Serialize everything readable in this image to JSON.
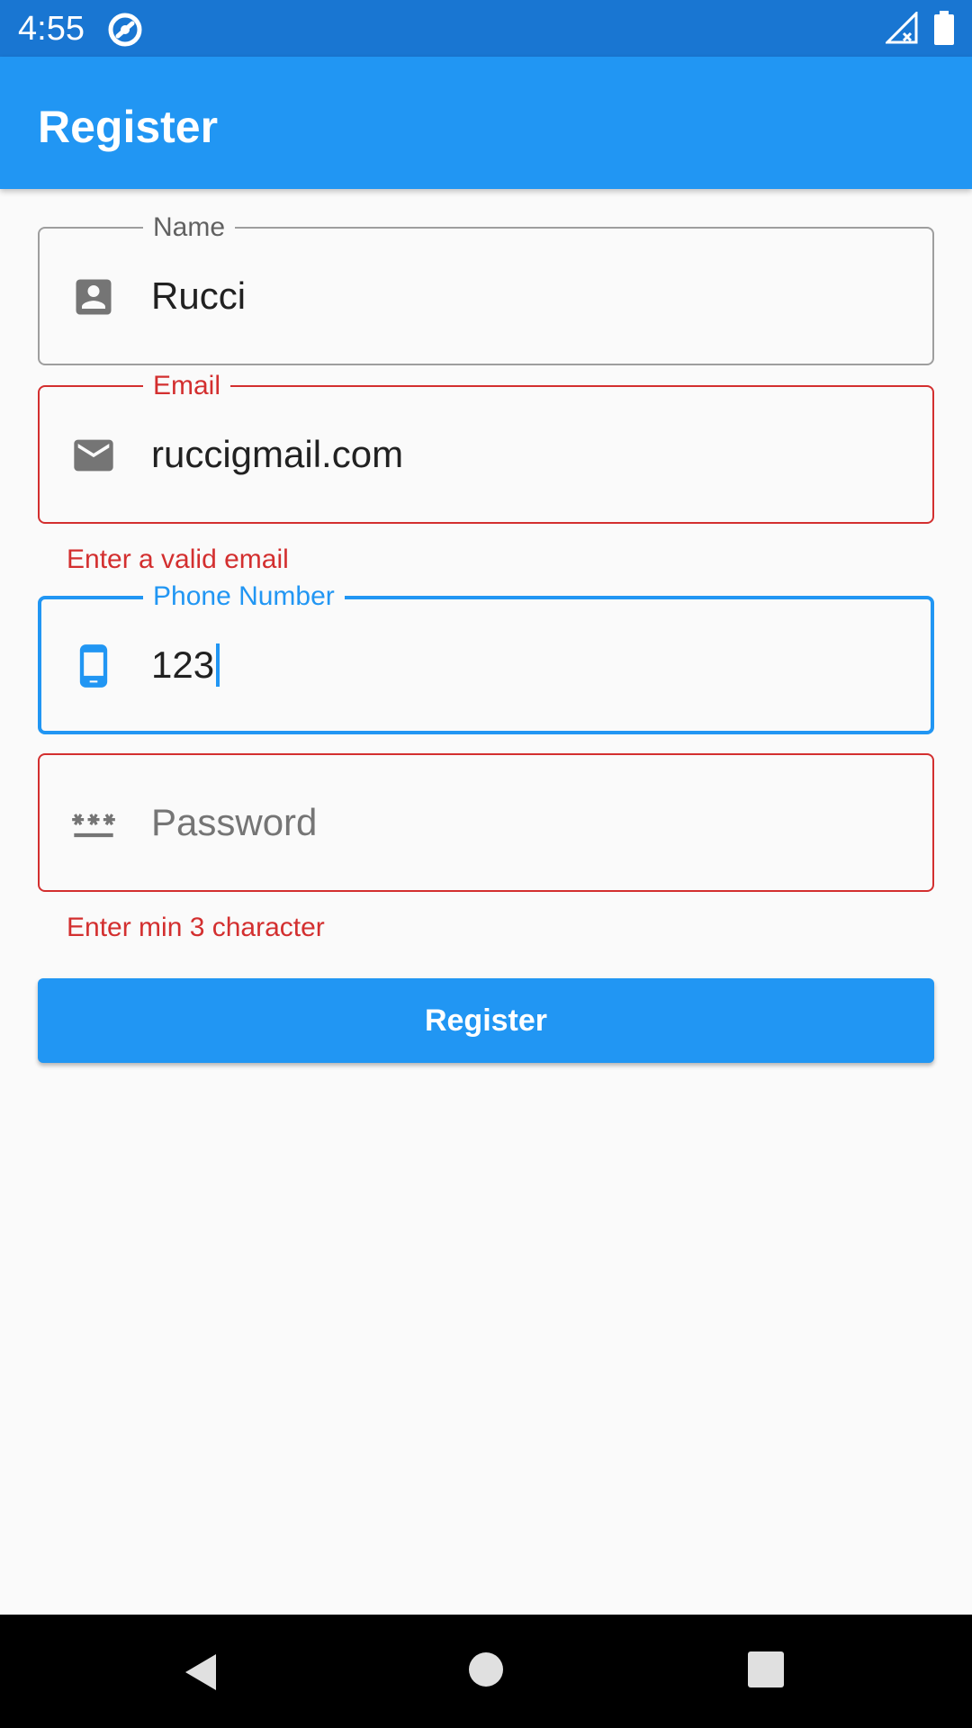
{
  "status_bar": {
    "time": "4:55",
    "icons": [
      "app-notification-icon",
      "signal-icon",
      "battery-icon"
    ]
  },
  "app_bar": {
    "title": "Register",
    "color": "#2196f3"
  },
  "form": {
    "name": {
      "label": "Name",
      "value": "Rucci",
      "icon": "person-icon"
    },
    "email": {
      "label": "Email",
      "value": "ruccigmail.com",
      "icon": "email-icon",
      "error": "Enter a valid email"
    },
    "phone": {
      "label": "Phone Number",
      "value": "123",
      "icon": "phone-icon",
      "focused": true
    },
    "password": {
      "placeholder": "Password",
      "value": "",
      "icon": "password-icon",
      "error": "Enter min 3 character"
    },
    "submit_label": "Register"
  },
  "nav_bar": {
    "buttons": [
      "back-icon",
      "home-icon",
      "recents-icon"
    ]
  },
  "colors": {
    "accent": "#2196f3",
    "status_bar": "#1976d2",
    "error": "#d32f2f",
    "outline": "#9e9e9e"
  }
}
